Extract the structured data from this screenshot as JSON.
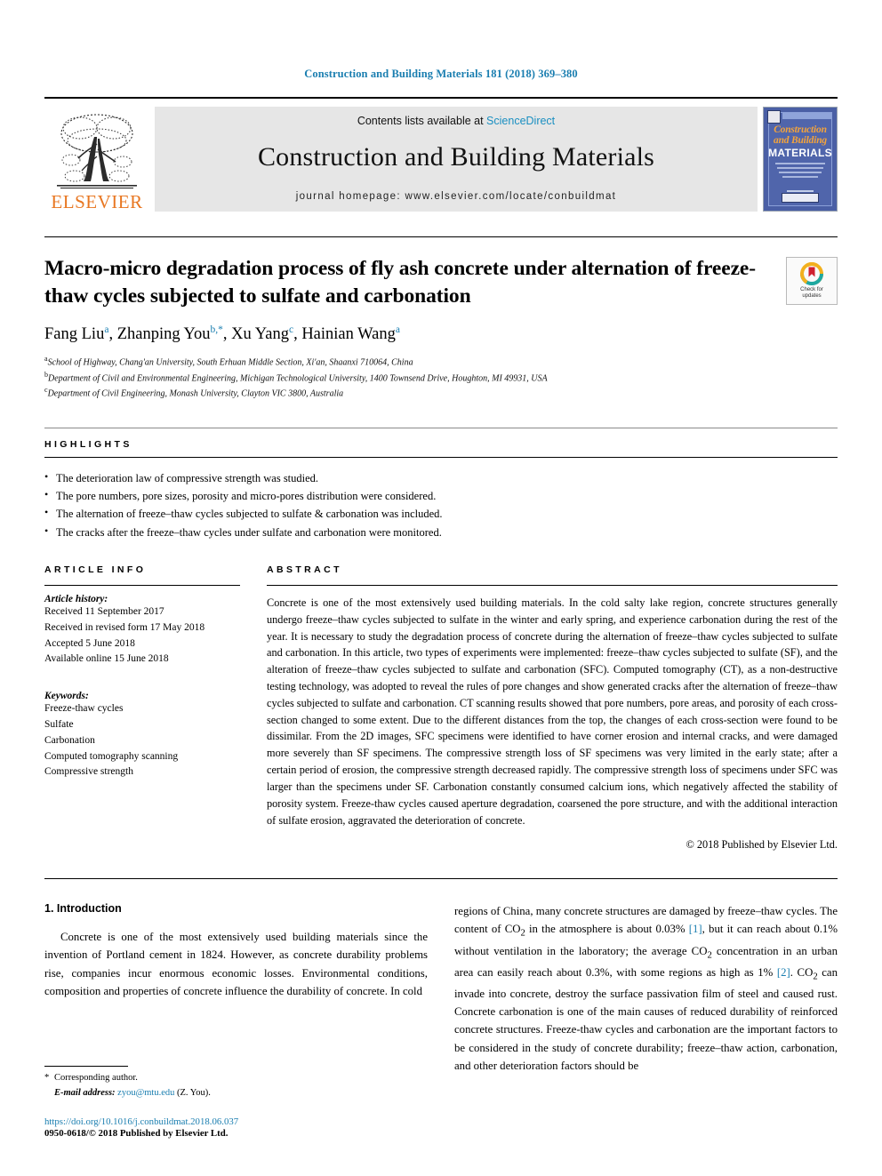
{
  "running_head": "Construction and Building Materials 181 (2018) 369–380",
  "masthead": {
    "contents_prefix": "Contents lists available at ",
    "sciencedirect": "ScienceDirect",
    "journal_title": "Construction and Building Materials",
    "homepage": "journal homepage: www.elsevier.com/locate/conbuildmat",
    "publisher_name": "ELSEVIER",
    "cover": {
      "line1": "Construction",
      "line2": "and Building",
      "line3": "MATERIALS"
    }
  },
  "article": {
    "title": "Macro-micro degradation process of fly ash concrete under alternation of freeze-thaw cycles subjected to sulfate and carbonation",
    "authors": [
      {
        "name": "Fang Liu",
        "marks": "a"
      },
      {
        "name": "Zhanping You",
        "marks": "b,*"
      },
      {
        "name": "Xu Yang",
        "marks": "c"
      },
      {
        "name": "Hainian Wang",
        "marks": "a"
      }
    ],
    "affiliations": [
      {
        "mark": "a",
        "text": "School of Highway, Chang'an University, South Erhuan Middle Section, Xi'an, Shaanxi 710064, China"
      },
      {
        "mark": "b",
        "text": "Department of Civil and Environmental Engineering, Michigan Technological University, 1400 Townsend Drive, Houghton, MI 49931, USA"
      },
      {
        "mark": "c",
        "text": "Department of Civil Engineering, Monash University, Clayton VIC 3800, Australia"
      }
    ],
    "crossmark_line1": "Check for",
    "crossmark_line2": "updates"
  },
  "highlights": {
    "label": "HIGHLIGHTS",
    "items": [
      "The deterioration law of compressive strength was studied.",
      "The pore numbers, pore sizes, porosity and micro-pores distribution were considered.",
      "The alternation of freeze–thaw cycles subjected to sulfate & carbonation was included.",
      "The cracks after the freeze–thaw cycles under sulfate and carbonation were monitored."
    ]
  },
  "article_info": {
    "label": "ARTICLE INFO",
    "history_title": "Article history:",
    "history": [
      "Received 11 September 2017",
      "Received in revised form 17 May 2018",
      "Accepted 5 June 2018",
      "Available online 15 June 2018"
    ],
    "keywords_title": "Keywords:",
    "keywords": [
      "Freeze-thaw cycles",
      "Sulfate",
      "Carbonation",
      "Computed tomography scanning",
      "Compressive strength"
    ]
  },
  "abstract": {
    "label": "ABSTRACT",
    "text": "Concrete is one of the most extensively used building materials. In the cold salty lake region, concrete structures generally undergo freeze–thaw cycles subjected to sulfate in the winter and early spring, and experience carbonation during the rest of the year. It is necessary to study the degradation process of concrete during the alternation of freeze–thaw cycles subjected to sulfate and carbonation. In this article, two types of experiments were implemented: freeze–thaw cycles subjected to sulfate (SF), and the alteration of freeze–thaw cycles subjected to sulfate and carbonation (SFC). Computed tomography (CT), as a non-destructive testing technology, was adopted to reveal the rules of pore changes and show generated cracks after the alternation of freeze–thaw cycles subjected to sulfate and carbonation. CT scanning results showed that pore numbers, pore areas, and porosity of each cross-section changed to some extent. Due to the different distances from the top, the changes of each cross-section were found to be dissimilar. From the 2D images, SFC specimens were identified to have corner erosion and internal cracks, and were damaged more severely than SF specimens. The compressive strength loss of SF specimens was very limited in the early state; after a certain period of erosion, the compressive strength decreased rapidly. The compressive strength loss of specimens under SFC was larger than the specimens under SF. Carbonation constantly consumed calcium ions, which negatively affected the stability of porosity system. Freeze-thaw cycles caused aperture degradation, coarsened the pore structure, and with the additional interaction of sulfate erosion, aggravated the deterioration of concrete.",
    "copyright": "© 2018 Published by Elsevier Ltd."
  },
  "introduction": {
    "heading": "1. Introduction",
    "left_paragraph": "Concrete is one of the most extensively used building materials since the invention of Portland cement in 1824. However, as concrete durability problems rise, companies incur enormous economic losses. Environmental conditions, composition and properties of concrete influence the durability of concrete. In cold",
    "right_part_1": "regions of China, many concrete structures are damaged by freeze–thaw cycles. The content of CO",
    "right_sub_1": "2",
    "right_part_2": " in the atmosphere is about 0.03% ",
    "right_cite_1": "[1]",
    "right_part_3": ", but it can reach about 0.1% without ventilation in the laboratory; the average CO",
    "right_sub_2": "2",
    "right_part_4": " concentration in an urban area can easily reach about 0.3%, with some regions as high as 1% ",
    "right_cite_2": "[2]",
    "right_part_5": ". CO",
    "right_sub_3": "2",
    "right_part_6": " can invade into concrete, destroy the surface passivation film of steel and caused rust. Concrete carbonation is one of the main causes of reduced durability of reinforced concrete structures. Freeze-thaw cycles and carbonation are the important factors to be considered in the study of concrete durability; freeze–thaw action, carbonation, and other deterioration factors should be"
  },
  "footer": {
    "corresponding_star": "*",
    "corresponding_label": "Corresponding author.",
    "email_label": "E-mail address:",
    "email": "zyou@mtu.edu",
    "email_suffix": " (Z. You).",
    "doi": "https://doi.org/10.1016/j.conbuildmat.2018.06.037",
    "issn": "0950-0618/© 2018 Published by Elsevier Ltd."
  },
  "colors": {
    "link": "#1a7eb0",
    "elsevier_orange": "#e87722",
    "masthead_gray": "#e6e6e6",
    "cover_blue": "#4a5fa5"
  }
}
